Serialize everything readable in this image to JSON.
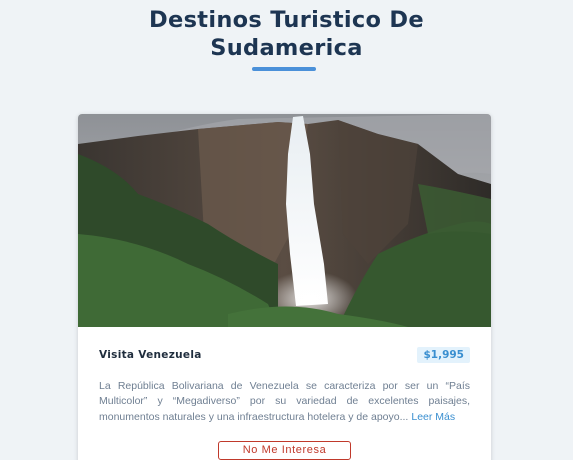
{
  "header": {
    "title_line1": "Destinos Turistico De",
    "title_line2": "Sudamerica"
  },
  "card": {
    "image_alt": "Salto Angel, Venezuela",
    "name": "Visita Venezuela",
    "price": "$1,995",
    "description": "La República Bolivariana de Venezuela se caracteriza por ser un “País Multicolor” y “Megadiverso” por su variedad de excelentes paisajes, monumentos naturales y una infraestructura hotelera y de apoyo...",
    "more_link": "Leer Más",
    "dismiss_button": "No Me Interesa"
  },
  "colors": {
    "background": "#eff3f6",
    "title": "#1d3552",
    "accent": "#4a90d9",
    "price_bg": "#e3f2fc",
    "price_text": "#3a8fd0",
    "danger": "#c0392b"
  },
  "icons": {
    "card_image": "waterfall-photo"
  }
}
